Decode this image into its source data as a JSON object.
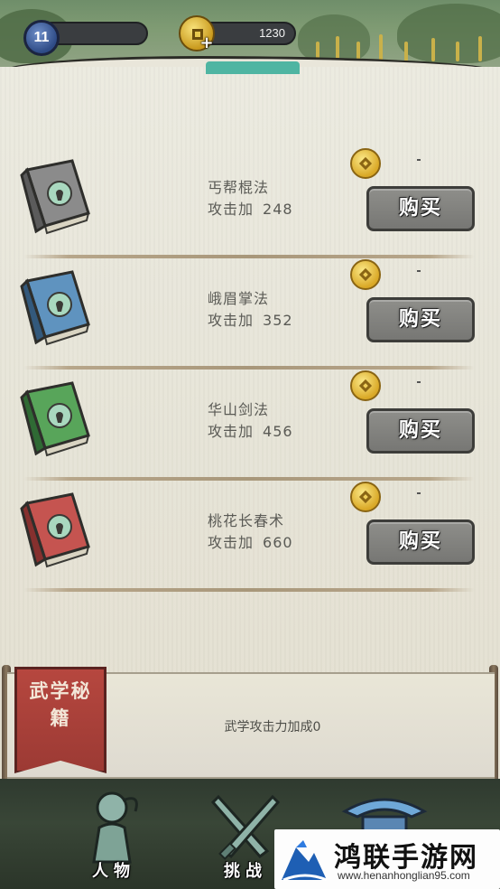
{
  "player": {
    "level": "11",
    "coins": "1230"
  },
  "skills": [
    {
      "name": "丐帮棍法",
      "stat_label": "攻击加",
      "stat_value": "248",
      "cover_color": "#8b8b8b",
      "cover_dark": "#5b5b5b",
      "buy_label": "购买"
    },
    {
      "name": "峨眉掌法",
      "stat_label": "攻击加",
      "stat_value": "352",
      "cover_color": "#5f93bf",
      "cover_dark": "#33597c",
      "buy_label": "购买"
    },
    {
      "name": "华山剑法",
      "stat_label": "攻击加",
      "stat_value": "456",
      "cover_color": "#58a55a",
      "cover_dark": "#2f6a34",
      "buy_label": "购买"
    },
    {
      "name": "桃花长春术",
      "stat_label": "攻击加",
      "stat_value": "660",
      "cover_color": "#c55450",
      "cover_dark": "#86302e",
      "buy_label": "购买"
    }
  ],
  "banner": {
    "title": "武学秘籍",
    "bonus_text": "武学攻击力加成0"
  },
  "nav": [
    {
      "label": "人物",
      "icon": "character-icon"
    },
    {
      "label": "挑战",
      "icon": "crossed-swords-icon"
    },
    {
      "label": "",
      "icon": "pavilion-icon"
    }
  ],
  "watermark": {
    "title": "鸿联手游网",
    "url": "www.henanhonglian95.com"
  },
  "colors": {
    "parchment": "#e8e5d8",
    "button_gray": "#848481",
    "coin_gold": "#e2b43a",
    "banner_red": "#a83f39"
  }
}
